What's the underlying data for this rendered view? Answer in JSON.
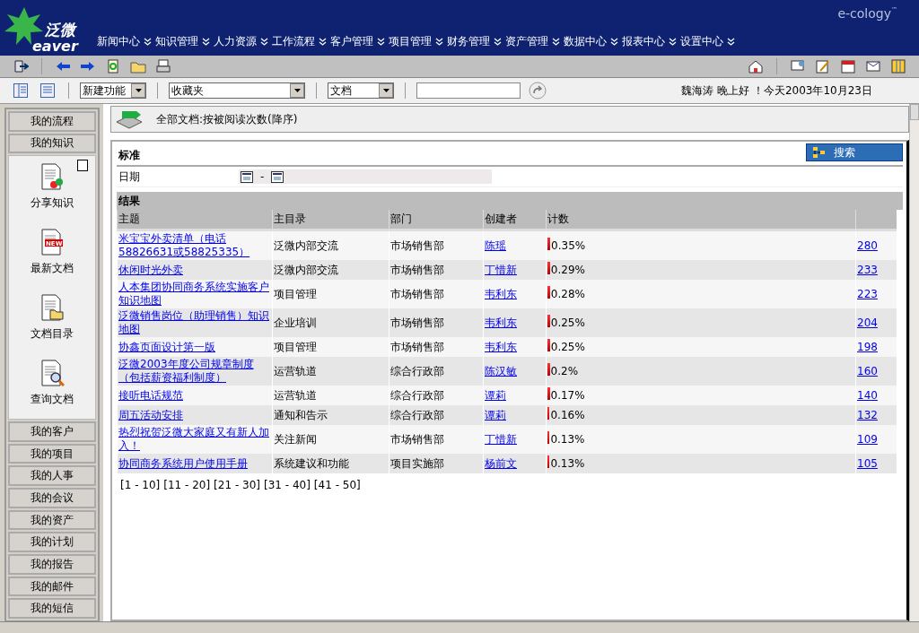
{
  "header": {
    "logo_cn": "泛微",
    "logo_en": "eaver",
    "brand": "e-cology",
    "brand_mark": "™",
    "nav": [
      "新闻中心",
      "知识管理",
      "人力资源",
      "工作流程",
      "客户管理",
      "项目管理",
      "财务管理",
      "资产管理",
      "数据中心",
      "报表中心",
      "设置中心"
    ]
  },
  "quickbar": {
    "selects": [
      "新建功能",
      "收藏夹",
      "文档"
    ],
    "greeting": "魏海涛 晚上好 ！今天2003年10月23日"
  },
  "sidebar": {
    "groups": [
      {
        "label": "我的流程",
        "expanded": false
      },
      {
        "label": "我的知识",
        "expanded": true,
        "children": [
          {
            "label": "分享知识",
            "kind": "share"
          },
          {
            "label": "最新文档",
            "kind": "new",
            "badge": "NEW"
          },
          {
            "label": "文档目录",
            "kind": "folder"
          },
          {
            "label": "查询文档",
            "kind": "search"
          }
        ]
      },
      {
        "label": "我的客户",
        "expanded": false
      },
      {
        "label": "我的项目",
        "expanded": false
      },
      {
        "label": "我的人事",
        "expanded": false
      },
      {
        "label": "我的会议",
        "expanded": false
      },
      {
        "label": "我的资产",
        "expanded": false
      },
      {
        "label": "我的计划",
        "expanded": false
      },
      {
        "label": "我的报告",
        "expanded": false
      },
      {
        "label": "我的邮件",
        "expanded": false
      },
      {
        "label": "我的短信",
        "expanded": false
      }
    ]
  },
  "page_title": "全部文档:按被阅读次数(降序)",
  "criteria": {
    "title": "标准",
    "search_button": "搜索",
    "date_label": "日期",
    "date_sep": "-"
  },
  "results": {
    "title": "结果",
    "columns": [
      "主题",
      "主目录",
      "部门",
      "创建者",
      "计数"
    ],
    "rows": [
      {
        "subject": "米宝宝外卖清单（电话58826631或58825335）",
        "catalog": "泛微内部交流",
        "dept": "市场销售部",
        "creator": "陈瑶",
        "percent": "0.35%",
        "level": 0.0035,
        "count": "280"
      },
      {
        "subject": "休闲时光外卖",
        "catalog": "泛微内部交流",
        "dept": "市场销售部",
        "creator": "丁惜新",
        "percent": "0.29%",
        "level": 0.0029,
        "count": "233"
      },
      {
        "subject": "人本集团协同商务系统实施客户知识地图",
        "catalog": "项目管理",
        "dept": "市场销售部",
        "creator": "韦利东",
        "percent": "0.28%",
        "level": 0.0028,
        "count": "223"
      },
      {
        "subject": "泛微销售岗位（助理销售）知识地图",
        "catalog": "企业培训",
        "dept": "市场销售部",
        "creator": "韦利东",
        "percent": "0.25%",
        "level": 0.0025,
        "count": "204"
      },
      {
        "subject": "协鑫页面设计第一版",
        "catalog": "项目管理",
        "dept": "市场销售部",
        "creator": "韦利东",
        "percent": "0.25%",
        "level": 0.0025,
        "count": "198"
      },
      {
        "subject": "泛微2003年度公司规章制度（包括薪资福利制度）",
        "catalog": "运营轨道",
        "dept": "综合行政部",
        "creator": "陈汉敏",
        "percent": "0.2%",
        "level": 0.002,
        "count": "160"
      },
      {
        "subject": "接听电话规范",
        "catalog": "运营轨道",
        "dept": "综合行政部",
        "creator": "谭莉",
        "percent": "0.17%",
        "level": 0.0017,
        "count": "140"
      },
      {
        "subject": "周五活动安排",
        "catalog": "通知和告示",
        "dept": "综合行政部",
        "creator": "谭莉",
        "percent": "0.16%",
        "level": 0.0016,
        "count": "132"
      },
      {
        "subject": "热烈祝贺泛微大家庭又有新人加入！",
        "catalog": "关注新闻",
        "dept": "市场销售部",
        "creator": "丁惜新",
        "percent": "0.13%",
        "level": 0.0013,
        "count": "109"
      },
      {
        "subject": "协同商务系统用户使用手册",
        "catalog": "系统建议和功能",
        "dept": "项目实施部",
        "creator": "杨前文",
        "percent": "0.13%",
        "level": 0.0013,
        "count": "105"
      }
    ],
    "pages": [
      "[1 - 10]",
      "[11 - 20]",
      "[21 - 30]",
      "[31 - 40]",
      "[41 - 50]"
    ]
  }
}
